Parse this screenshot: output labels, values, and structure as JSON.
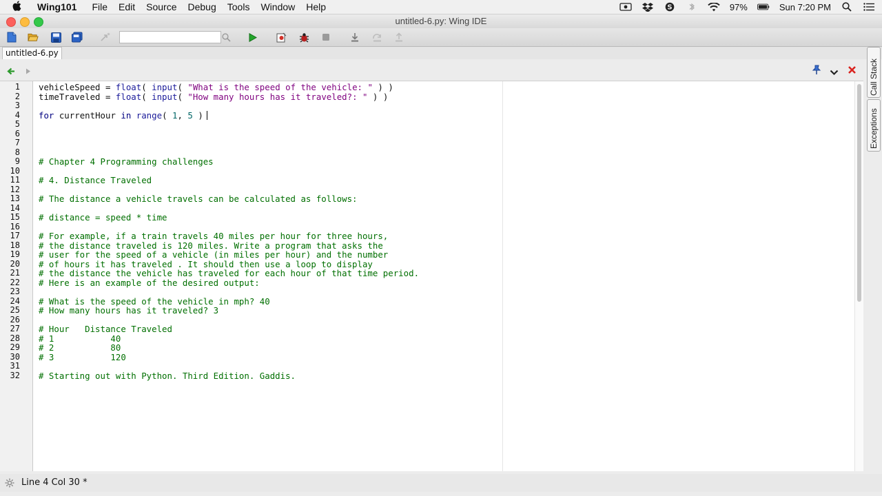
{
  "menubar": {
    "app_name": "Wing101",
    "items": [
      "File",
      "Edit",
      "Source",
      "Debug",
      "Tools",
      "Window",
      "Help"
    ],
    "battery": "97%",
    "clock": "Sun 7:20 PM"
  },
  "window": {
    "title": "untitled-6.py: Wing IDE"
  },
  "toolbar": {
    "search_value": ""
  },
  "tabs": [
    {
      "label": "untitled-6.py"
    }
  ],
  "status": {
    "text": "Line 4 Col 30 *"
  },
  "side_tabs": [
    "Call Stack",
    "Exceptions"
  ],
  "editor": {
    "caret": {
      "line": 4,
      "col": 30
    },
    "lines": [
      [
        [
          "vehicleSpeed = ",
          ""
        ],
        [
          "float",
          "bi"
        ],
        [
          "( ",
          ""
        ],
        [
          "input",
          "bi"
        ],
        [
          "( ",
          ""
        ],
        [
          "\"What is the speed of the vehicle: \"",
          "str"
        ],
        [
          " ) )",
          ""
        ]
      ],
      [
        [
          "timeTraveled = ",
          ""
        ],
        [
          "float",
          "bi"
        ],
        [
          "( ",
          ""
        ],
        [
          "input",
          "bi"
        ],
        [
          "( ",
          ""
        ],
        [
          "\"How many hours has it traveled?: \"",
          "str"
        ],
        [
          " ) )",
          ""
        ]
      ],
      [],
      [
        [
          "for",
          "kw"
        ],
        [
          " currentHour ",
          ""
        ],
        [
          "in",
          "kw"
        ],
        [
          " ",
          ""
        ],
        [
          "range",
          "bi"
        ],
        [
          "( ",
          ""
        ],
        [
          "1",
          "num"
        ],
        [
          ", ",
          ""
        ],
        [
          "5",
          "num"
        ],
        [
          " )",
          ""
        ]
      ],
      [],
      [],
      [],
      [],
      [
        [
          "# Chapter 4 Programming challenges",
          "cm"
        ]
      ],
      [],
      [
        [
          "# 4. Distance Traveled",
          "cm"
        ]
      ],
      [],
      [
        [
          "# The distance a vehicle travels can be calculated as follows:",
          "cm"
        ]
      ],
      [],
      [
        [
          "# distance = speed * time",
          "cm"
        ]
      ],
      [],
      [
        [
          "# For example, if a train travels 40 miles per hour for three hours,",
          "cm"
        ]
      ],
      [
        [
          "# the distance traveled is 120 miles. Write a program that asks the",
          "cm"
        ]
      ],
      [
        [
          "# user for the speed of a vehicle (in miles per hour) and the number",
          "cm"
        ]
      ],
      [
        [
          "# of hours it has traveled . It should then use a loop to display",
          "cm"
        ]
      ],
      [
        [
          "# the distance the vehicle has traveled for each hour of that time period.",
          "cm"
        ]
      ],
      [
        [
          "# Here is an example of the desired output:",
          "cm"
        ]
      ],
      [],
      [
        [
          "# What is the speed of the vehicle in mph? 40",
          "cm"
        ]
      ],
      [
        [
          "# How many hours has it traveled? 3",
          "cm"
        ]
      ],
      [],
      [
        [
          "# Hour   Distance Traveled",
          "cm"
        ]
      ],
      [
        [
          "# 1           40",
          "cm"
        ]
      ],
      [
        [
          "# 2           80",
          "cm"
        ]
      ],
      [
        [
          "# 3           120",
          "cm"
        ]
      ],
      [],
      [
        [
          "# Starting out with Python. Third Edition. Gaddis.",
          "cm"
        ]
      ]
    ]
  },
  "colors": {
    "keyword": "#000080",
    "builtin": "#1a1a99",
    "string": "#7f007f",
    "number": "#006666",
    "comment": "#006f00",
    "close_red": "#d9231f"
  }
}
